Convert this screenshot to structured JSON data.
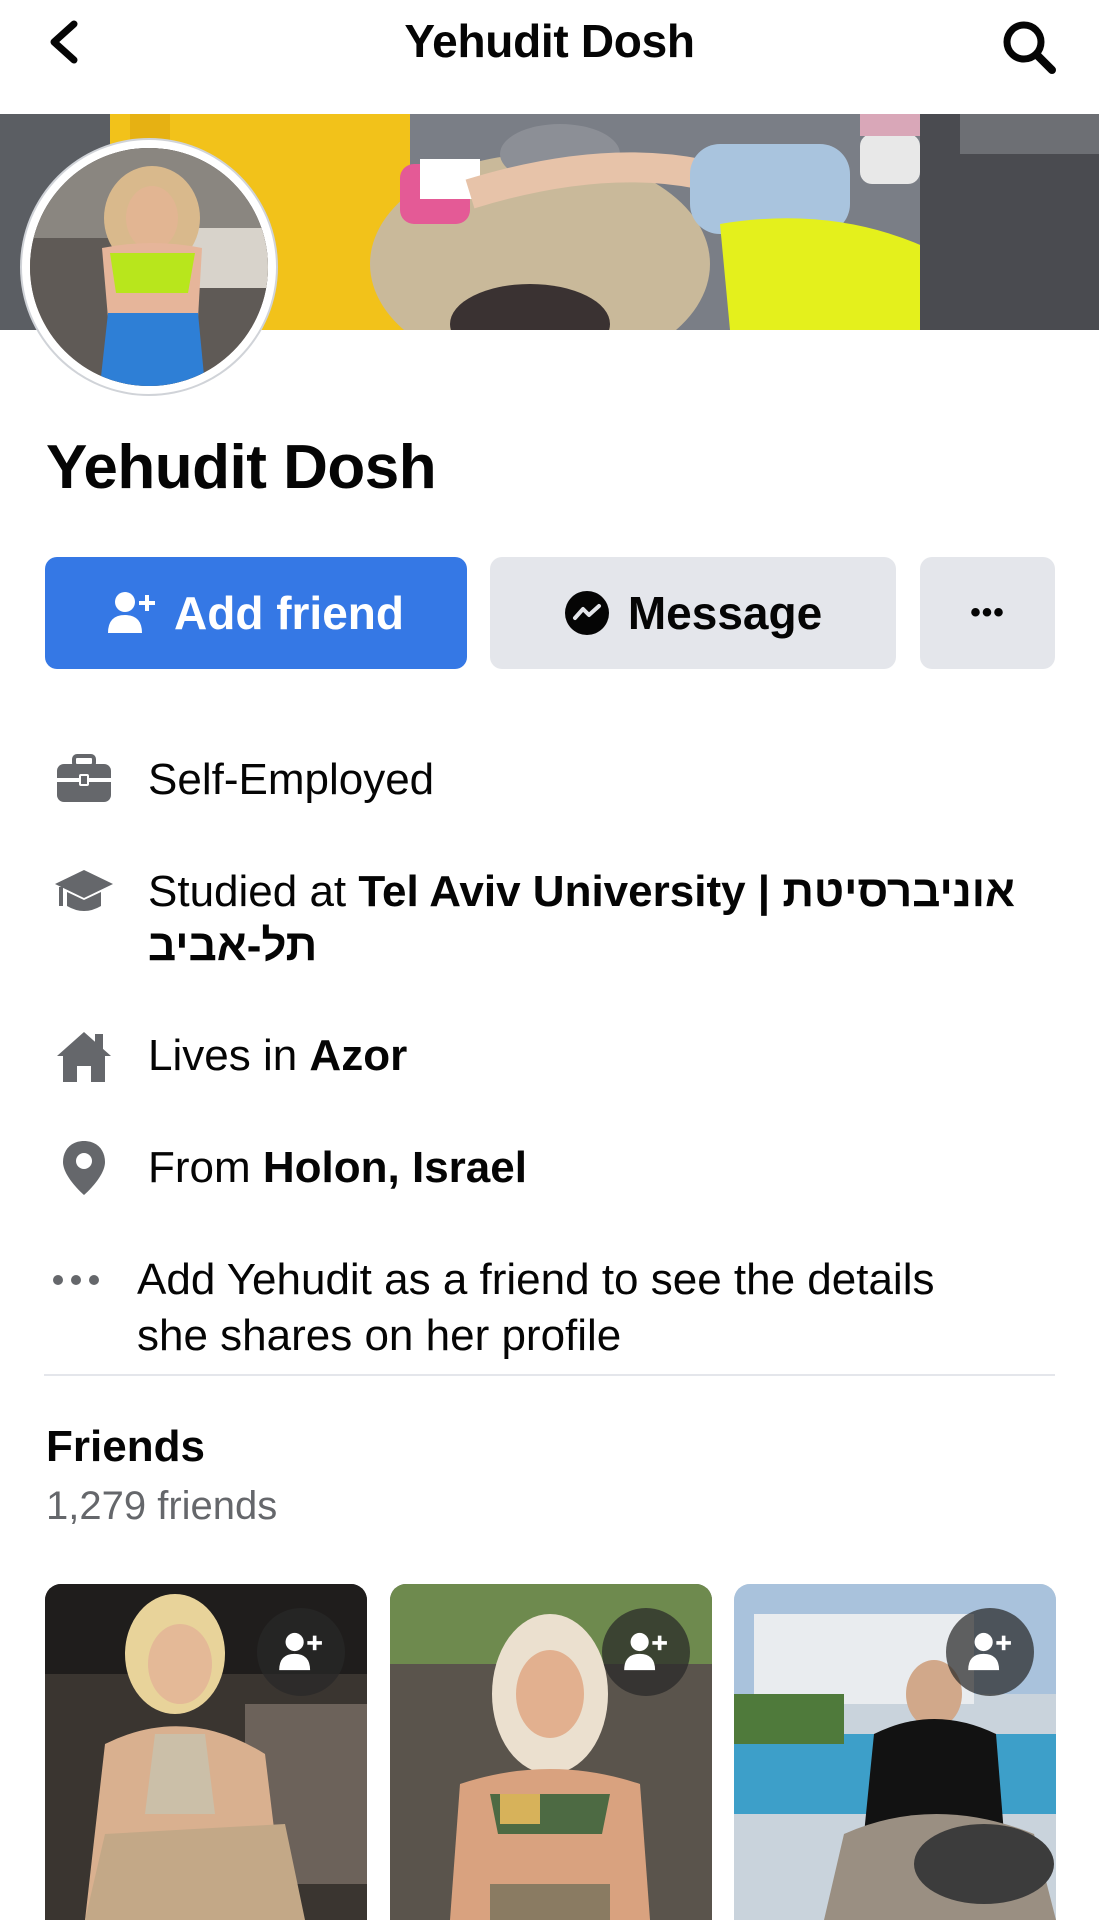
{
  "header": {
    "title": "Yehudit Dosh",
    "back_icon": "chevron-left-icon",
    "search_icon": "search-icon"
  },
  "profile": {
    "name": "Yehudit Dosh"
  },
  "actions": {
    "add_friend_label": "Add friend",
    "message_label": "Message",
    "more_label": "•••",
    "accent": "#3578e5"
  },
  "intro": {
    "work": "Self-Employed",
    "study_prefix": "Studied at ",
    "study_school": "Tel Aviv University | אוניברסיטת",
    "study_school_line2": "תל-אביב",
    "lives_prefix": "Lives in ",
    "lives_place": "Azor",
    "from_prefix": "From ",
    "from_place": "Holon, Israel",
    "more_line1": "Add Yehudit as a friend to see the details",
    "more_line2": "she shares on her profile"
  },
  "friends": {
    "title": "Friends",
    "count": "1,279 friends"
  }
}
